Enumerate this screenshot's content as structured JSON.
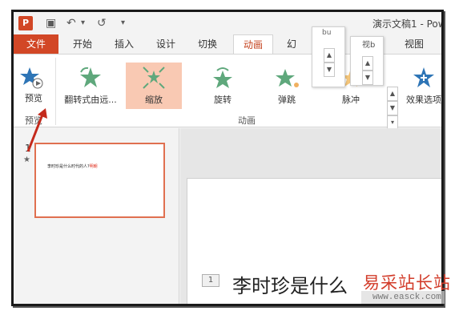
{
  "app": {
    "icon_letter": "P",
    "doc_title": "演示文稿1 - Pow"
  },
  "qat": {
    "save_glyph": "▣",
    "undo_glyph": "↶",
    "undo_dropdown": "▾",
    "redo_glyph": "↺",
    "more_glyph": "▾"
  },
  "tabs": [
    {
      "label": "文件"
    },
    {
      "label": "开始"
    },
    {
      "label": "插入"
    },
    {
      "label": "设计"
    },
    {
      "label": "切换"
    },
    {
      "label": "动画"
    },
    {
      "label": "幻"
    },
    {
      "label": "视图"
    }
  ],
  "ribbon": {
    "preview": {
      "label": "预览",
      "group": "预览"
    },
    "animations": [
      {
        "label": "翻转式由远..."
      },
      {
        "label": "缩放"
      },
      {
        "label": "旋转"
      },
      {
        "label": "弹跳"
      },
      {
        "label": "脉冲"
      }
    ],
    "group_label": "动画",
    "effect_options": {
      "label": "效果选项"
    },
    "popup_partial_1": "bu",
    "popup_partial_2": "视b"
  },
  "slides_panel": {
    "slide_number": "1",
    "star": "★",
    "thumb_text_black": "李时珍是什么时代的人?",
    "thumb_text_red": "明朝"
  },
  "editor": {
    "slide_badge": "1",
    "title_text": "李时珍是什么"
  },
  "watermark": {
    "main": "易采站长站",
    "sub": "www.easck.com"
  },
  "colors": {
    "accent": "#d24726",
    "selected": "#f9c9b3",
    "star_green": "#5fa87c",
    "star_blue": "#2e75b6",
    "arrow": "#c42a1c"
  }
}
